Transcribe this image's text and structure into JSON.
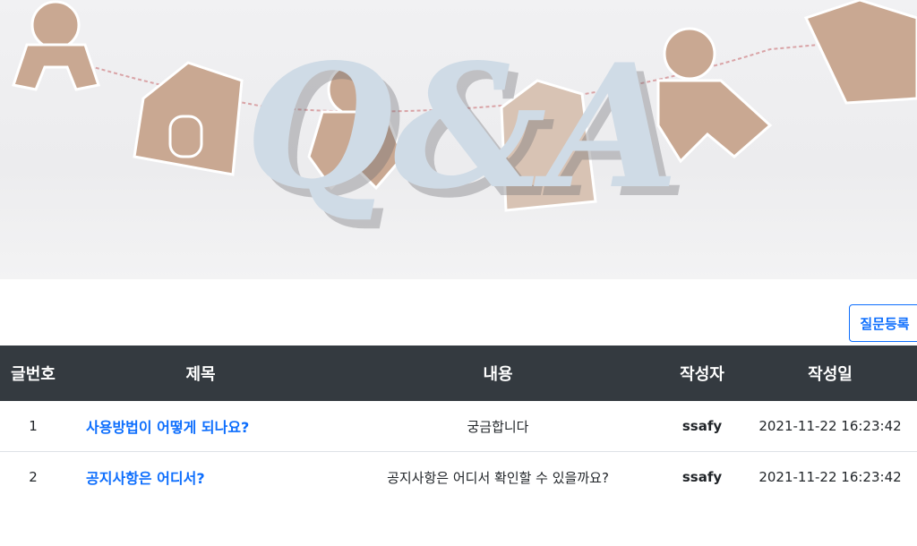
{
  "banner": {
    "logo_text": "Q&A"
  },
  "toolbar": {
    "register_label": "질문등록"
  },
  "colors": {
    "header_bg": "#343a40",
    "link": "#0d6efd",
    "logo": "#cfdbe6"
  },
  "table": {
    "headers": [
      "글번호",
      "제목",
      "내용",
      "작성자",
      "작성일"
    ],
    "rows": [
      {
        "no": "1",
        "title": "사용방법이 어떻게 되나요?",
        "content": "궁금합니다",
        "author": "ssafy",
        "date": "2021-11-22 16:23:42"
      },
      {
        "no": "2",
        "title": "공지사항은 어디서?",
        "content": "공지사항은 어디서 확인할 수 있을까요?",
        "author": "ssafy",
        "date": "2021-11-22 16:23:42"
      }
    ]
  }
}
